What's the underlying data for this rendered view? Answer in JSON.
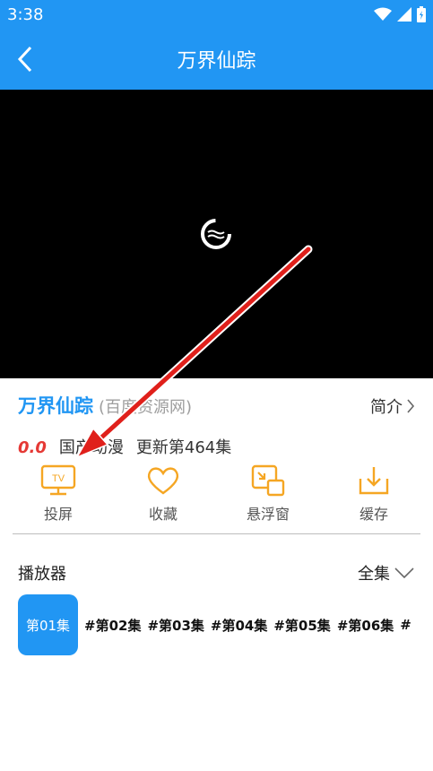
{
  "status_bar": {
    "time": "3:38"
  },
  "header": {
    "title": "万界仙踪"
  },
  "info": {
    "title": "万界仙踪",
    "source": "(百度资源网)",
    "intro_label": "简介",
    "rating": "0.0",
    "genre": "国产动漫",
    "update": "更新第464集"
  },
  "actions": [
    {
      "label": "投屏",
      "icon": "tv-cast-icon"
    },
    {
      "label": "收藏",
      "icon": "heart-icon"
    },
    {
      "label": "悬浮窗",
      "icon": "floating-window-icon"
    },
    {
      "label": "缓存",
      "icon": "download-icon"
    }
  ],
  "player_section": {
    "label": "播放器",
    "all_label": "全集"
  },
  "episodes": {
    "active": "第01集",
    "items": [
      "#第02集",
      "#第03集",
      "#第04集",
      "#第05集",
      "#第06集",
      "#"
    ]
  },
  "colors": {
    "primary": "#2196F3",
    "accent": "#F5A623",
    "rating": "#E53935",
    "annotation": "#E0201B"
  }
}
